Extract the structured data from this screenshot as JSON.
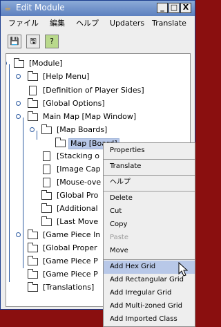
{
  "window": {
    "title": "Edit Module",
    "title_icon": "java-cup-icon",
    "controls": {
      "minimize": "_",
      "maximize": "□",
      "close": "X"
    }
  },
  "menubar": [
    "ファイル",
    "編集",
    "ヘルプ",
    "Updaters",
    "Translate"
  ],
  "toolbar": [
    "save-icon",
    "save-as-icon",
    "validate-icon"
  ],
  "tree": {
    "nodes": [
      {
        "label": "[Module]",
        "type": "folder"
      },
      {
        "label": "[Help Menu]",
        "type": "folder"
      },
      {
        "label": "[Definition of Player Sides]",
        "type": "doc"
      },
      {
        "label": "[Global Options]",
        "type": "folder"
      },
      {
        "label": "Main Map [Map Window]",
        "type": "folder"
      },
      {
        "label": "[Map Boards]",
        "type": "folder"
      },
      {
        "label": "Map [Board]",
        "type": "folder",
        "selected": true
      },
      {
        "label": "[Stacking o",
        "type": "doc"
      },
      {
        "label": "[Image Cap",
        "type": "doc"
      },
      {
        "label": "[Mouse-ove",
        "type": "doc"
      },
      {
        "label": "[Global Pro",
        "type": "folder"
      },
      {
        "label": "[Additional",
        "type": "folder"
      },
      {
        "label": "[Last Move",
        "type": "folder"
      },
      {
        "label": "[Game Piece In",
        "type": "folder"
      },
      {
        "label": "[Global Proper",
        "type": "folder"
      },
      {
        "label": "[Game Piece P",
        "type": "folder"
      },
      {
        "label": "[Game Piece P",
        "type": "folder"
      },
      {
        "label": "[Translations]",
        "type": "folder"
      }
    ]
  },
  "context_menu": {
    "items": [
      {
        "label": "Properties"
      },
      {
        "label": "Translate"
      },
      {
        "label": "ヘルプ"
      },
      {
        "label": "Delete"
      },
      {
        "label": "Cut"
      },
      {
        "label": "Copy"
      },
      {
        "label": "Paste",
        "disabled": true
      },
      {
        "label": "Move"
      },
      {
        "label": "Add Hex Grid",
        "highlight": true
      },
      {
        "label": "Add Rectangular Grid"
      },
      {
        "label": "Add Irregular Grid"
      },
      {
        "label": "Add Multi-zoned Grid"
      },
      {
        "label": "Add Imported Class"
      }
    ]
  }
}
